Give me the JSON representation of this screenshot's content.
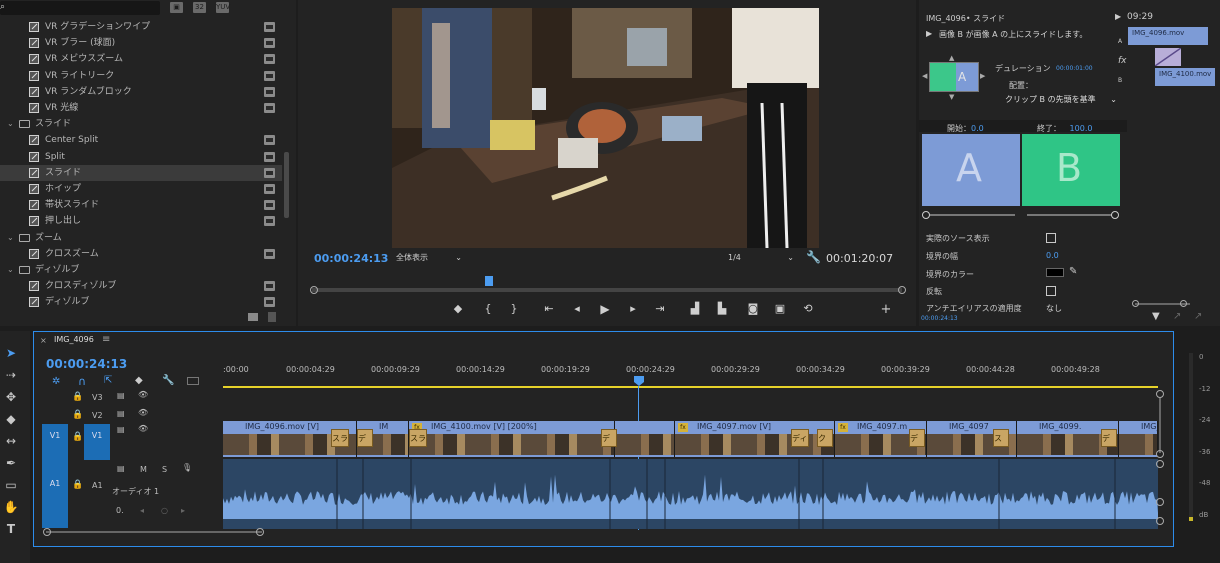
{
  "effects": {
    "search_icons": [
      "new-bin-icon",
      "32-icon",
      "yuv-icon"
    ],
    "items": [
      {
        "type": "effect",
        "label": "VR グラデーションワイプ"
      },
      {
        "type": "effect",
        "label": "VR ブラー (球面)"
      },
      {
        "type": "effect",
        "label": "VR メビウスズーム"
      },
      {
        "type": "effect",
        "label": "VR ライトリーク"
      },
      {
        "type": "effect",
        "label": "VR ランダムブロック"
      },
      {
        "type": "effect",
        "label": "VR 光線"
      },
      {
        "type": "folder",
        "label": "スライド"
      },
      {
        "type": "effect",
        "label": "Center Split"
      },
      {
        "type": "effect",
        "label": "Split"
      },
      {
        "type": "effect",
        "label": "スライド",
        "selected": true
      },
      {
        "type": "effect",
        "label": "ホイップ"
      },
      {
        "type": "effect",
        "label": "帯状スライド"
      },
      {
        "type": "effect",
        "label": "押し出し"
      },
      {
        "type": "folder",
        "label": "ズーム"
      },
      {
        "type": "effect",
        "label": "クロスズーム"
      },
      {
        "type": "folder",
        "label": "ディゾルブ"
      },
      {
        "type": "effect",
        "label": "クロスディゾルブ"
      },
      {
        "type": "effect",
        "label": "ディゾルブ"
      }
    ]
  },
  "program": {
    "timecode_current": "00:00:24:13",
    "zoom_label": "全体表示",
    "resolution_label": "1/4",
    "timecode_duration": "00:01:20:07",
    "playhead_fraction": 0.3
  },
  "effect_controls": {
    "title": "IMG_4096• スライド",
    "description": "画像 B が画像 A の上にスライドします。",
    "duration_label": "デュレーション",
    "duration_value": "00:00:01:00",
    "alignment_label": "配置：",
    "alignment_value": "クリップ B の先頭を基準",
    "start_label": "開始：",
    "start_value": "0.0",
    "end_label": "終了：",
    "end_value": "100.0",
    "preview_a": "A",
    "preview_b": "B",
    "show_actual_sources": "実際のソース表示",
    "border_width_label": "境界の幅",
    "border_width_value": "0.0",
    "border_color_label": "境界のカラー",
    "reverse_label": "反転",
    "antialias_label": "アンチエイリアスの適用度",
    "antialias_value": "なし",
    "footer_timecode": "00:00:24:13",
    "mini_time": "09:29",
    "mini_clip_a": "IMG_4096.mov",
    "mini_clip_b": "IMG_4100.mov",
    "side_label_a": "A",
    "side_label_b": "B",
    "fx_label": "fx"
  },
  "timeline": {
    "sequence_name": "IMG_4096",
    "timecode": "00:00:24:13",
    "ruler": [
      ":00:00",
      "00:00:04:29",
      "00:00:09:29",
      "00:00:14:29",
      "00:00:19:29",
      "00:00:24:29",
      "00:00:29:29",
      "00:00:34:29",
      "00:00:39:29",
      "00:00:44:28",
      "00:00:49:28"
    ],
    "tracks": {
      "v3": "V3",
      "v2": "V2",
      "v1": "V1",
      "v1_src": "V1",
      "a1": "A1",
      "a1_src": "A1",
      "audio_name": "オーディオ 1",
      "m": "M",
      "s": "S",
      "vol": "0."
    },
    "clips": [
      {
        "label": "IMG_4096.mov [V]"
      },
      {
        "label": "IM"
      },
      {
        "label": "IMG_4100.mov [V] [200%]"
      },
      {
        "label": "IMG_4097.mov [V]"
      },
      {
        "label": "IMG_4097.m"
      },
      {
        "label": "IMG_4097"
      },
      {
        "label": "IMG_4099."
      },
      {
        "label": "IMG_4"
      }
    ],
    "transitions": [
      "スラ",
      "ディ",
      "スラ",
      "ディ",
      "ディ",
      "ク",
      "ディ",
      "スラ",
      "ディ"
    ],
    "fx": "fx"
  },
  "meter": {
    "scale": [
      "0",
      "-12",
      "-24",
      "-36",
      "-48",
      "dB"
    ]
  }
}
